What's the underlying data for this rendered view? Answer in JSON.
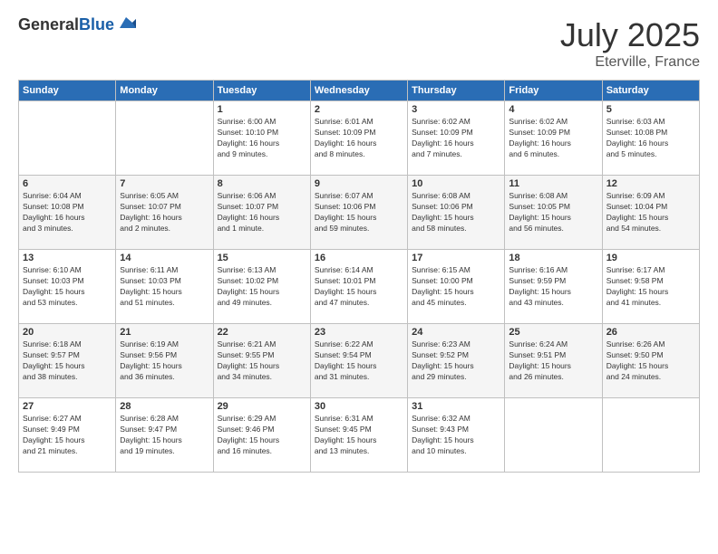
{
  "header": {
    "logo_general": "General",
    "logo_blue": "Blue",
    "title": "July 2025",
    "location": "Eterville, France"
  },
  "weekdays": [
    "Sunday",
    "Monday",
    "Tuesday",
    "Wednesday",
    "Thursday",
    "Friday",
    "Saturday"
  ],
  "rows": [
    [
      {
        "day": "",
        "info": ""
      },
      {
        "day": "",
        "info": ""
      },
      {
        "day": "1",
        "info": "Sunrise: 6:00 AM\nSunset: 10:10 PM\nDaylight: 16 hours\nand 9 minutes."
      },
      {
        "day": "2",
        "info": "Sunrise: 6:01 AM\nSunset: 10:09 PM\nDaylight: 16 hours\nand 8 minutes."
      },
      {
        "day": "3",
        "info": "Sunrise: 6:02 AM\nSunset: 10:09 PM\nDaylight: 16 hours\nand 7 minutes."
      },
      {
        "day": "4",
        "info": "Sunrise: 6:02 AM\nSunset: 10:09 PM\nDaylight: 16 hours\nand 6 minutes."
      },
      {
        "day": "5",
        "info": "Sunrise: 6:03 AM\nSunset: 10:08 PM\nDaylight: 16 hours\nand 5 minutes."
      }
    ],
    [
      {
        "day": "6",
        "info": "Sunrise: 6:04 AM\nSunset: 10:08 PM\nDaylight: 16 hours\nand 3 minutes."
      },
      {
        "day": "7",
        "info": "Sunrise: 6:05 AM\nSunset: 10:07 PM\nDaylight: 16 hours\nand 2 minutes."
      },
      {
        "day": "8",
        "info": "Sunrise: 6:06 AM\nSunset: 10:07 PM\nDaylight: 16 hours\nand 1 minute."
      },
      {
        "day": "9",
        "info": "Sunrise: 6:07 AM\nSunset: 10:06 PM\nDaylight: 15 hours\nand 59 minutes."
      },
      {
        "day": "10",
        "info": "Sunrise: 6:08 AM\nSunset: 10:06 PM\nDaylight: 15 hours\nand 58 minutes."
      },
      {
        "day": "11",
        "info": "Sunrise: 6:08 AM\nSunset: 10:05 PM\nDaylight: 15 hours\nand 56 minutes."
      },
      {
        "day": "12",
        "info": "Sunrise: 6:09 AM\nSunset: 10:04 PM\nDaylight: 15 hours\nand 54 minutes."
      }
    ],
    [
      {
        "day": "13",
        "info": "Sunrise: 6:10 AM\nSunset: 10:03 PM\nDaylight: 15 hours\nand 53 minutes."
      },
      {
        "day": "14",
        "info": "Sunrise: 6:11 AM\nSunset: 10:03 PM\nDaylight: 15 hours\nand 51 minutes."
      },
      {
        "day": "15",
        "info": "Sunrise: 6:13 AM\nSunset: 10:02 PM\nDaylight: 15 hours\nand 49 minutes."
      },
      {
        "day": "16",
        "info": "Sunrise: 6:14 AM\nSunset: 10:01 PM\nDaylight: 15 hours\nand 47 minutes."
      },
      {
        "day": "17",
        "info": "Sunrise: 6:15 AM\nSunset: 10:00 PM\nDaylight: 15 hours\nand 45 minutes."
      },
      {
        "day": "18",
        "info": "Sunrise: 6:16 AM\nSunset: 9:59 PM\nDaylight: 15 hours\nand 43 minutes."
      },
      {
        "day": "19",
        "info": "Sunrise: 6:17 AM\nSunset: 9:58 PM\nDaylight: 15 hours\nand 41 minutes."
      }
    ],
    [
      {
        "day": "20",
        "info": "Sunrise: 6:18 AM\nSunset: 9:57 PM\nDaylight: 15 hours\nand 38 minutes."
      },
      {
        "day": "21",
        "info": "Sunrise: 6:19 AM\nSunset: 9:56 PM\nDaylight: 15 hours\nand 36 minutes."
      },
      {
        "day": "22",
        "info": "Sunrise: 6:21 AM\nSunset: 9:55 PM\nDaylight: 15 hours\nand 34 minutes."
      },
      {
        "day": "23",
        "info": "Sunrise: 6:22 AM\nSunset: 9:54 PM\nDaylight: 15 hours\nand 31 minutes."
      },
      {
        "day": "24",
        "info": "Sunrise: 6:23 AM\nSunset: 9:52 PM\nDaylight: 15 hours\nand 29 minutes."
      },
      {
        "day": "25",
        "info": "Sunrise: 6:24 AM\nSunset: 9:51 PM\nDaylight: 15 hours\nand 26 minutes."
      },
      {
        "day": "26",
        "info": "Sunrise: 6:26 AM\nSunset: 9:50 PM\nDaylight: 15 hours\nand 24 minutes."
      }
    ],
    [
      {
        "day": "27",
        "info": "Sunrise: 6:27 AM\nSunset: 9:49 PM\nDaylight: 15 hours\nand 21 minutes."
      },
      {
        "day": "28",
        "info": "Sunrise: 6:28 AM\nSunset: 9:47 PM\nDaylight: 15 hours\nand 19 minutes."
      },
      {
        "day": "29",
        "info": "Sunrise: 6:29 AM\nSunset: 9:46 PM\nDaylight: 15 hours\nand 16 minutes."
      },
      {
        "day": "30",
        "info": "Sunrise: 6:31 AM\nSunset: 9:45 PM\nDaylight: 15 hours\nand 13 minutes."
      },
      {
        "day": "31",
        "info": "Sunrise: 6:32 AM\nSunset: 9:43 PM\nDaylight: 15 hours\nand 10 minutes."
      },
      {
        "day": "",
        "info": ""
      },
      {
        "day": "",
        "info": ""
      }
    ]
  ]
}
